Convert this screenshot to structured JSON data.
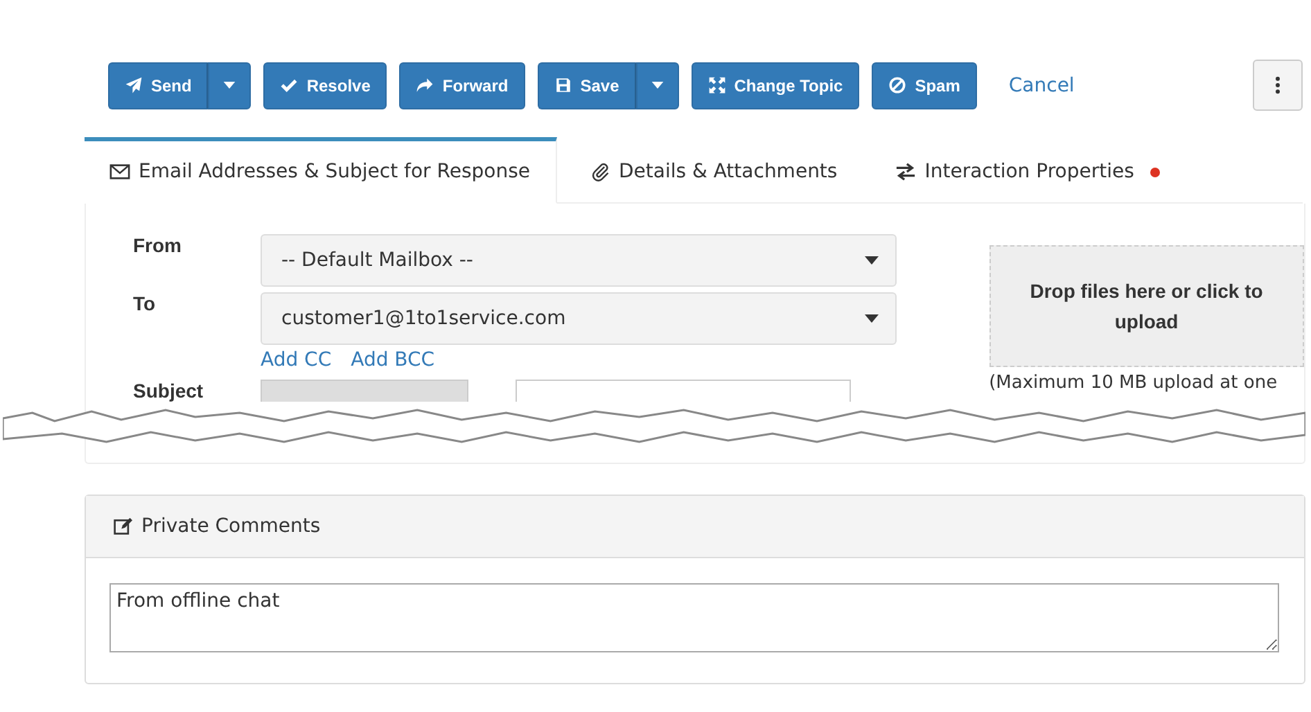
{
  "toolbar": {
    "buttons": [
      {
        "label": "Send",
        "kind": "split"
      },
      {
        "label": "Resolve",
        "kind": "plain"
      },
      {
        "label": "Forward",
        "kind": "plain"
      },
      {
        "label": "Save",
        "kind": "split"
      },
      {
        "label": "Change Topic",
        "kind": "plain"
      },
      {
        "label": "Spam",
        "kind": "plain"
      }
    ],
    "cancel": "Cancel"
  },
  "tabs": [
    {
      "label": "Email Addresses & Subject for Response",
      "selected": true,
      "alert": false
    },
    {
      "label": "Details & Attachments",
      "selected": false,
      "alert": false
    },
    {
      "label": "Interaction Properties",
      "selected": false,
      "alert": true
    }
  ],
  "form": {
    "from": {
      "label": "From",
      "value": "-- Default Mailbox --"
    },
    "to": {
      "label": "To",
      "value": "customer1@1to1service.com"
    },
    "links": [
      "Add CC",
      "Add BCC"
    ],
    "subject": {
      "label": "Subject"
    },
    "dropzone": {
      "text": "Drop files here or click to upload",
      "note": "(Maximum 10 MB upload at one"
    }
  },
  "comments": {
    "title": "Private Comments",
    "value": "From offline chat"
  }
}
